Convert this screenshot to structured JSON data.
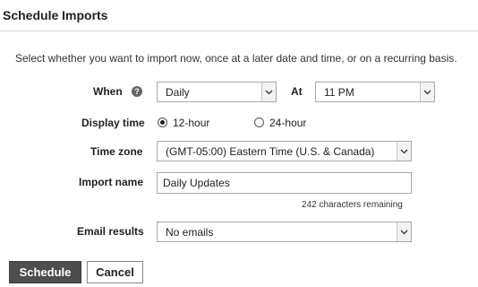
{
  "dialog": {
    "title": "Schedule Imports",
    "intro": "Select whether you want to import now, once at a later date and time, or on a recurring basis."
  },
  "when": {
    "label": "When",
    "help_icon": "help-icon",
    "frequency_value": "Daily",
    "at_label": "At",
    "time_value": "11 PM"
  },
  "display_time": {
    "label": "Display time",
    "options": [
      {
        "label": "12-hour",
        "selected": true
      },
      {
        "label": "24-hour",
        "selected": false
      }
    ]
  },
  "time_zone": {
    "label": "Time zone",
    "value": "(GMT-05:00) Eastern Time (U.S. & Canada)"
  },
  "import_name": {
    "label": "Import name",
    "value": "Daily Updates",
    "remaining": "242 characters remaining"
  },
  "email_results": {
    "label": "Email results",
    "value": "No emails"
  },
  "actions": {
    "schedule_label": "Schedule",
    "cancel_label": "Cancel"
  },
  "colors": {
    "primary_button": "#4e4e4e",
    "border": "#a9a9a9"
  }
}
